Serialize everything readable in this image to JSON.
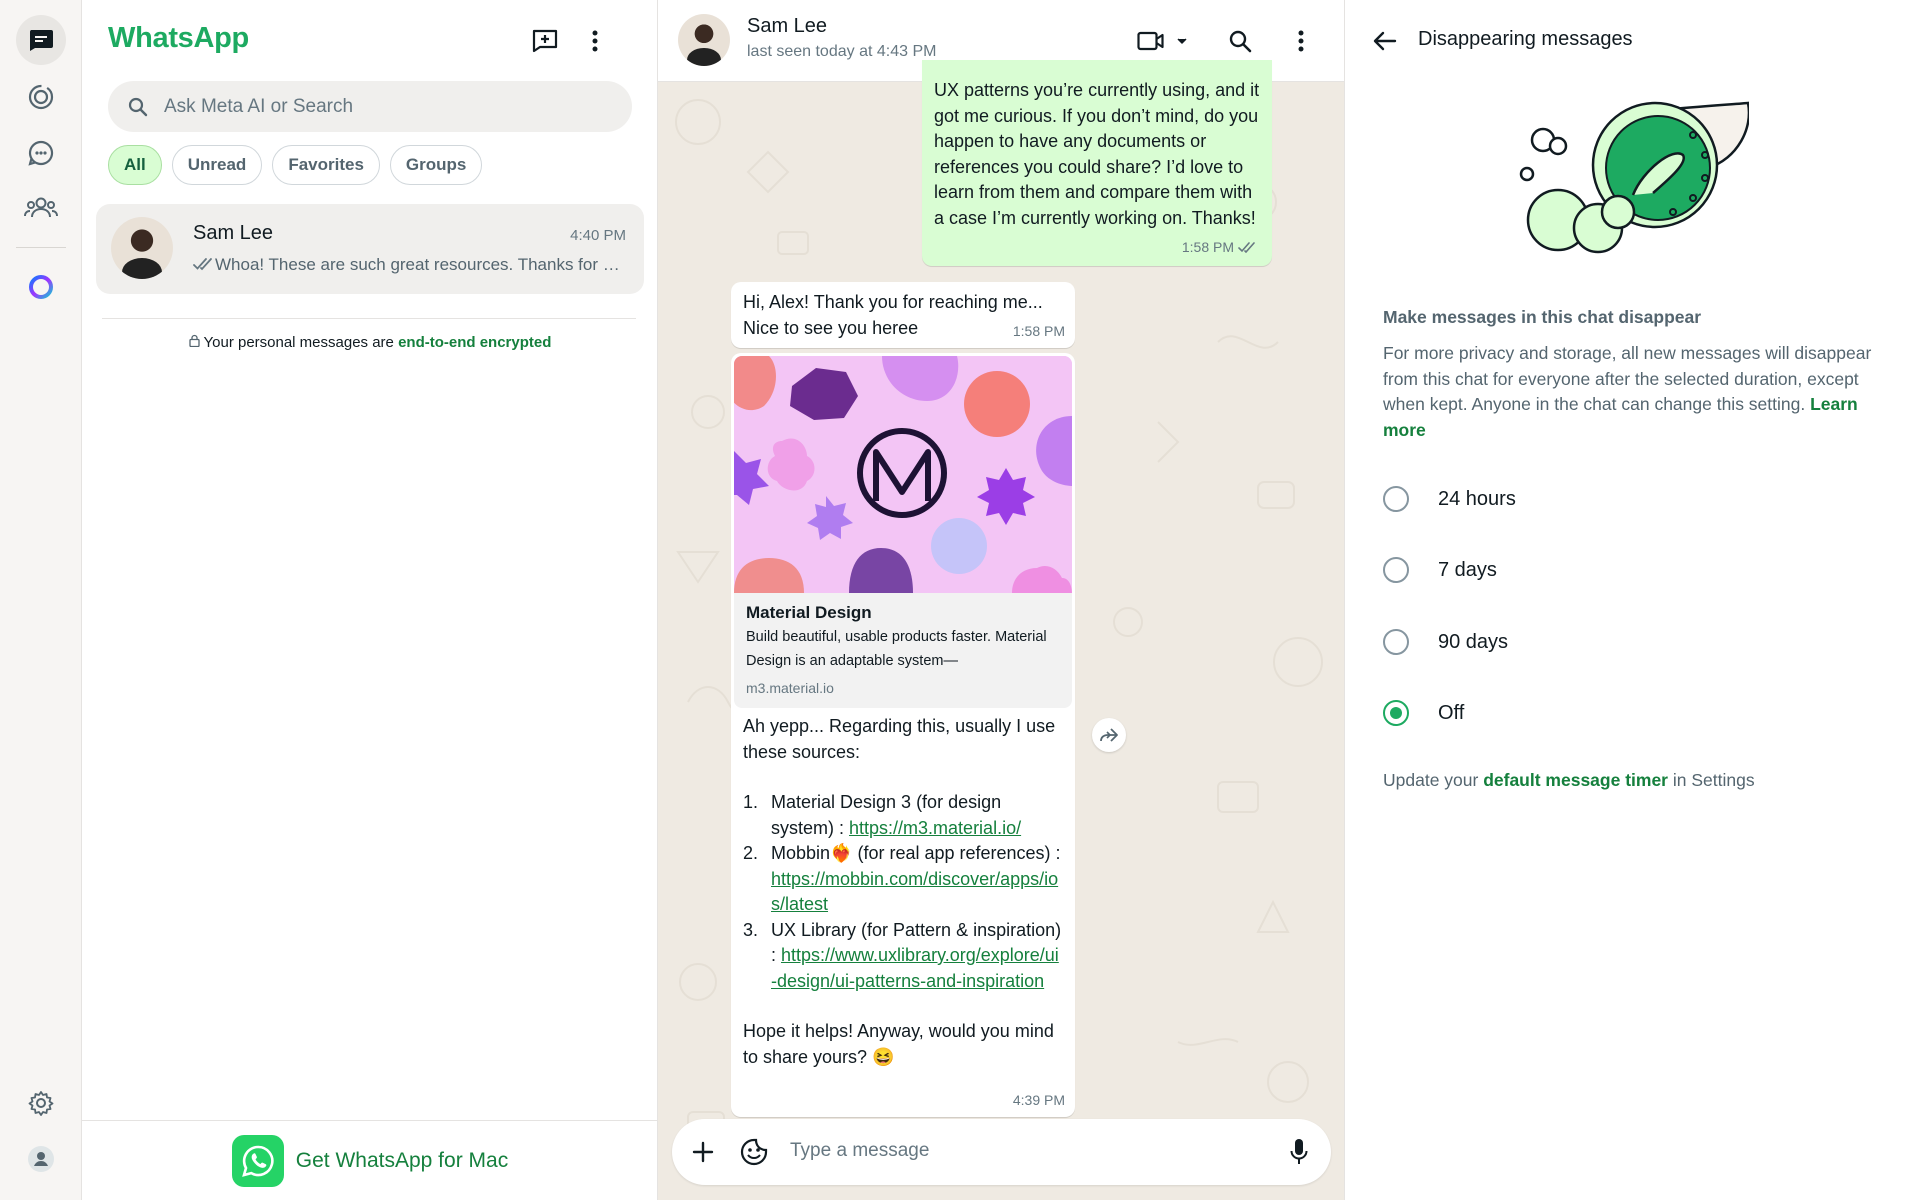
{
  "app": {
    "name": "WhatsApp"
  },
  "nav": {
    "items": [
      {
        "name": "chats",
        "icon": "chats-icon"
      },
      {
        "name": "status",
        "icon": "status-icon"
      },
      {
        "name": "channels",
        "icon": "channels-icon"
      },
      {
        "name": "communities",
        "icon": "communities-icon"
      },
      {
        "name": "meta-ai",
        "icon": "meta-ai-icon"
      }
    ],
    "bottom": [
      {
        "name": "settings",
        "icon": "gear-icon"
      },
      {
        "name": "profile",
        "icon": "profile-icon"
      }
    ]
  },
  "sidebar": {
    "title": "WhatsApp",
    "search_placeholder": "Ask Meta AI or Search",
    "filters": [
      "All",
      "Unread",
      "Favorites",
      "Groups"
    ],
    "active_filter": "All",
    "chats": [
      {
        "name": "Sam Lee",
        "time": "4:40 PM",
        "preview": "Whoa! These are such great resources. Thanks for sharing them with me!"
      }
    ],
    "encryption_text": "Your personal messages are ",
    "encryption_link": "end-to-end encrypted",
    "get_app_label": "Get WhatsApp for Mac"
  },
  "conversation": {
    "contact_name": "Sam Lee",
    "contact_status": "last seen today at 4:43 PM",
    "messages": [
      {
        "direction": "outgoing",
        "text": "UX patterns you’re currently using, and it got me curious. If you don’t mind, do you happen to have any documents or references you could share? I’d love to learn from them and compare them with a case I’m currently working on. Thanks!",
        "time": "1:58 PM"
      },
      {
        "direction": "incoming",
        "text": "Hi, Alex! Thank you for reaching me... Nice to see you heree",
        "time": "1:58 PM"
      },
      {
        "direction": "incoming",
        "link_preview": {
          "title": "Material Design",
          "description": "Build beautiful, usable products faster. Material Design is an adaptable system—",
          "domain": "m3.material.io"
        },
        "intro": "Ah yepp... Regarding this, usually I use these sources:",
        "list": [
          {
            "num": "1.",
            "text": "Material Design 3 (for design system) : ",
            "link": "https://m3.material.io/"
          },
          {
            "num": "2.",
            "text": "Mobbin❤️‍🔥 (for real app references) : ",
            "link": "https://mobbin.com/discover/apps/ios/latest"
          },
          {
            "num": "3.",
            "text": "UX Library (for Pattern & inspiration) : ",
            "link": "https://www.uxlibrary.org/explore/ui-design/ui-patterns-and-inspiration"
          }
        ],
        "outro": "Hope it helps! Anyway, would you mind to share yours? 😆",
        "time": "4:39 PM"
      }
    ],
    "composer_placeholder": "Type a message"
  },
  "disappearing": {
    "title": "Disappearing messages",
    "heading": "Make messages in this chat disappear",
    "description": "For more privacy and storage, all new messages will disappear from this chat for everyone after the selected duration, except when kept. Anyone in the chat can change this setting. ",
    "learn_more": "Learn more",
    "options": [
      "24 hours",
      "7 days",
      "90 days",
      "Off"
    ],
    "selected": "Off",
    "footer_prefix": "Update your ",
    "footer_link": "default message timer",
    "footer_suffix": " in Settings"
  },
  "colors": {
    "brand_green": "#1daa61",
    "link_green": "#15803d",
    "outgoing_bubble": "#d9fdd3",
    "chat_background": "#efeae2"
  }
}
